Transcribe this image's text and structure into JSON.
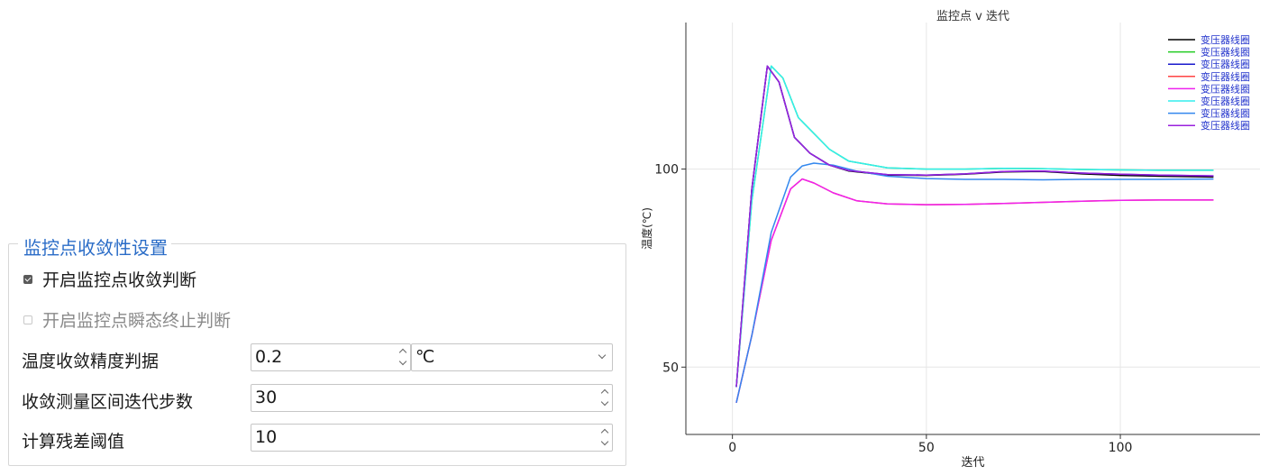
{
  "settings": {
    "group_title": "监控点收敛性设置",
    "enable_convergence_check": {
      "label": "开启监控点收敛判断",
      "checked": true
    },
    "enable_transient_stop": {
      "label": "开启监控点瞬态终止判断",
      "checked": false,
      "disabled": true
    },
    "temp_precision": {
      "label": "温度收敛精度判据",
      "value": "0.2",
      "unit": "℃"
    },
    "measure_steps": {
      "label": "收敛测量区间迭代步数",
      "value": "30"
    },
    "residual_threshold": {
      "label": "计算残差阈值",
      "value": "10"
    }
  },
  "chart_data": {
    "type": "line",
    "title": "监控点 v 迭代",
    "xlabel": "迭代",
    "ylabel": "温度(℃)",
    "xlim": [
      -12,
      136
    ],
    "ylim": [
      33,
      137
    ],
    "xticks": [
      0,
      50,
      100
    ],
    "yticks": [
      50,
      100
    ],
    "grid": true,
    "legend_position": "top-right",
    "series": [
      {
        "name": "变压器线圈",
        "color": "#000000",
        "x": [
          1,
          5,
          9,
          12,
          16,
          20,
          25,
          30,
          40,
          50,
          60,
          70,
          80,
          90,
          100,
          110,
          124
        ],
        "y": [
          45,
          95,
          126,
          122,
          108,
          104,
          101,
          99.5,
          98.5,
          98.4,
          98.7,
          99.3,
          99.4,
          98.8,
          98.4,
          98.2,
          98.0
        ]
      },
      {
        "name": "变压器线圈",
        "color": "#22cc22",
        "x": [
          1,
          5,
          10,
          13,
          17,
          21,
          25,
          30,
          40,
          50,
          60,
          70,
          80,
          90,
          100,
          110,
          124
        ],
        "y": [
          45,
          92,
          126,
          123,
          113,
          109,
          105,
          102,
          100.3,
          100.0,
          100.0,
          100.2,
          100.1,
          99.9,
          99.8,
          99.7,
          99.7
        ]
      },
      {
        "name": "变压器线圈",
        "color": "#1a1acc",
        "x": [
          1,
          5,
          9,
          12,
          16,
          20,
          25,
          30,
          40,
          50,
          60,
          70,
          80,
          90,
          100,
          110,
          124
        ],
        "y": [
          45,
          95,
          126,
          122,
          108,
          104,
          101,
          99.6,
          98.6,
          98.5,
          98.8,
          99.4,
          99.5,
          99.0,
          98.7,
          98.5,
          98.3
        ]
      },
      {
        "name": "变压器线圈",
        "color": "#ff4444",
        "x": [
          1,
          5,
          10,
          15,
          18,
          21,
          26,
          32,
          40,
          50,
          60,
          70,
          80,
          90,
          100,
          110,
          124
        ],
        "y": [
          41,
          58,
          82,
          95,
          97.5,
          96.5,
          94,
          92,
          91.2,
          91.0,
          91.1,
          91.3,
          91.6,
          91.9,
          92.1,
          92.2,
          92.2
        ]
      },
      {
        "name": "变压器线圈",
        "color": "#ee22ee",
        "x": [
          1,
          5,
          10,
          15,
          18,
          21,
          26,
          32,
          40,
          50,
          60,
          70,
          80,
          90,
          100,
          110,
          124
        ],
        "y": [
          41,
          58,
          82,
          95,
          97.5,
          96.5,
          94,
          92,
          91.2,
          91.0,
          91.1,
          91.3,
          91.6,
          91.9,
          92.1,
          92.2,
          92.2
        ]
      },
      {
        "name": "变压器线圈",
        "color": "#33eeee",
        "x": [
          1,
          5,
          10,
          13,
          17,
          21,
          25,
          30,
          40,
          50,
          60,
          70,
          80,
          90,
          100,
          110,
          124
        ],
        "y": [
          45,
          92,
          126,
          123,
          113,
          109,
          105,
          102,
          100.3,
          100.0,
          100.0,
          100.2,
          100.1,
          99.9,
          99.8,
          99.7,
          99.7
        ]
      },
      {
        "name": "变压器线圈",
        "color": "#3388ee",
        "x": [
          1,
          5,
          10,
          15,
          18,
          21,
          26,
          32,
          40,
          50,
          60,
          70,
          80,
          90,
          100,
          110,
          124
        ],
        "y": [
          41,
          58,
          84,
          98,
          100.8,
          101.5,
          101,
          99.5,
          98.2,
          97.6,
          97.4,
          97.4,
          97.3,
          97.4,
          97.4,
          97.4,
          97.5
        ]
      },
      {
        "name": "变压器线圈",
        "color": "#9922dd",
        "x": [
          1,
          5,
          9,
          12,
          16,
          20,
          25,
          30,
          40,
          50,
          60,
          70,
          80,
          90,
          100,
          110,
          124
        ],
        "y": [
          45,
          95,
          126,
          122,
          108,
          104,
          101,
          99.6,
          98.6,
          98.5,
          98.8,
          99.4,
          99.5,
          99.0,
          98.7,
          98.5,
          98.3
        ]
      }
    ]
  }
}
